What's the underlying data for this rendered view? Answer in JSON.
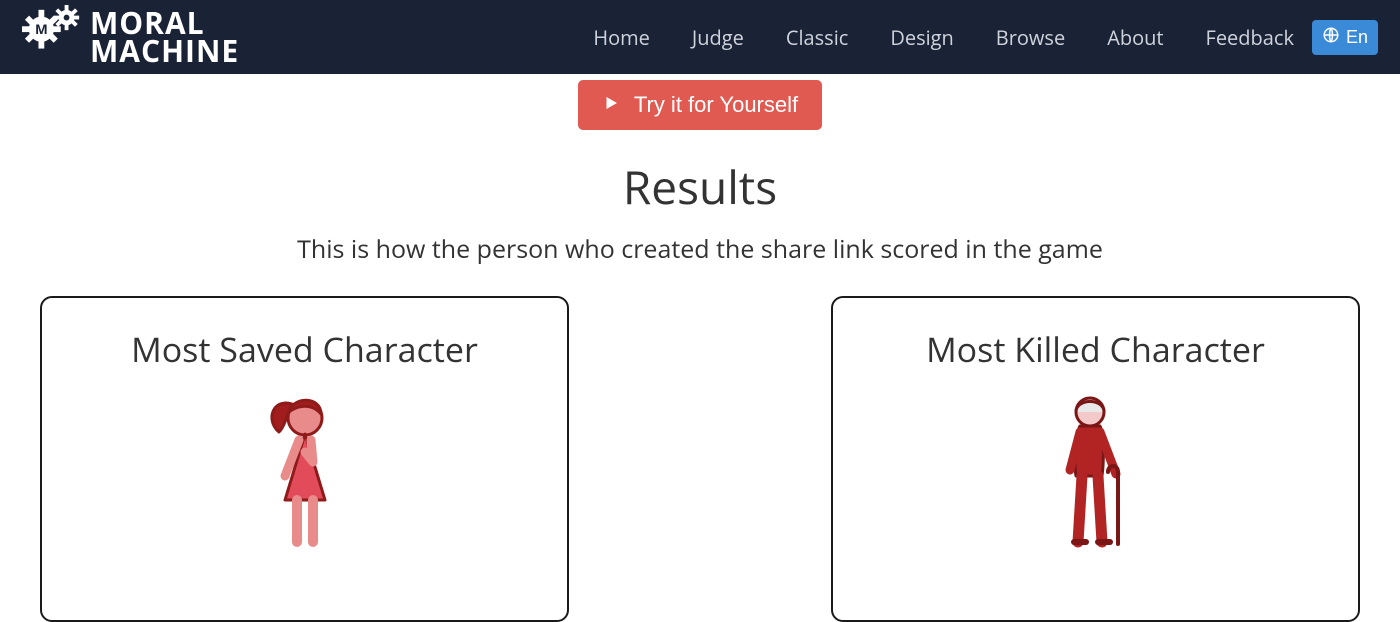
{
  "brand": {
    "line1": "MORAL",
    "line2": "MACHINE"
  },
  "nav": {
    "items": [
      {
        "label": "Home"
      },
      {
        "label": "Judge"
      },
      {
        "label": "Classic"
      },
      {
        "label": "Design"
      },
      {
        "label": "Browse"
      },
      {
        "label": "About"
      },
      {
        "label": "Feedback"
      }
    ],
    "lang_label": "En"
  },
  "cta": {
    "label": "Try it for Yourself"
  },
  "results": {
    "title": "Results",
    "subtitle": "This is how the person who created the share link scored in the game"
  },
  "cards": {
    "saved": {
      "title": "Most Saved Character",
      "character": "girl"
    },
    "killed": {
      "title": "Most Killed Character",
      "character": "old-man"
    }
  }
}
